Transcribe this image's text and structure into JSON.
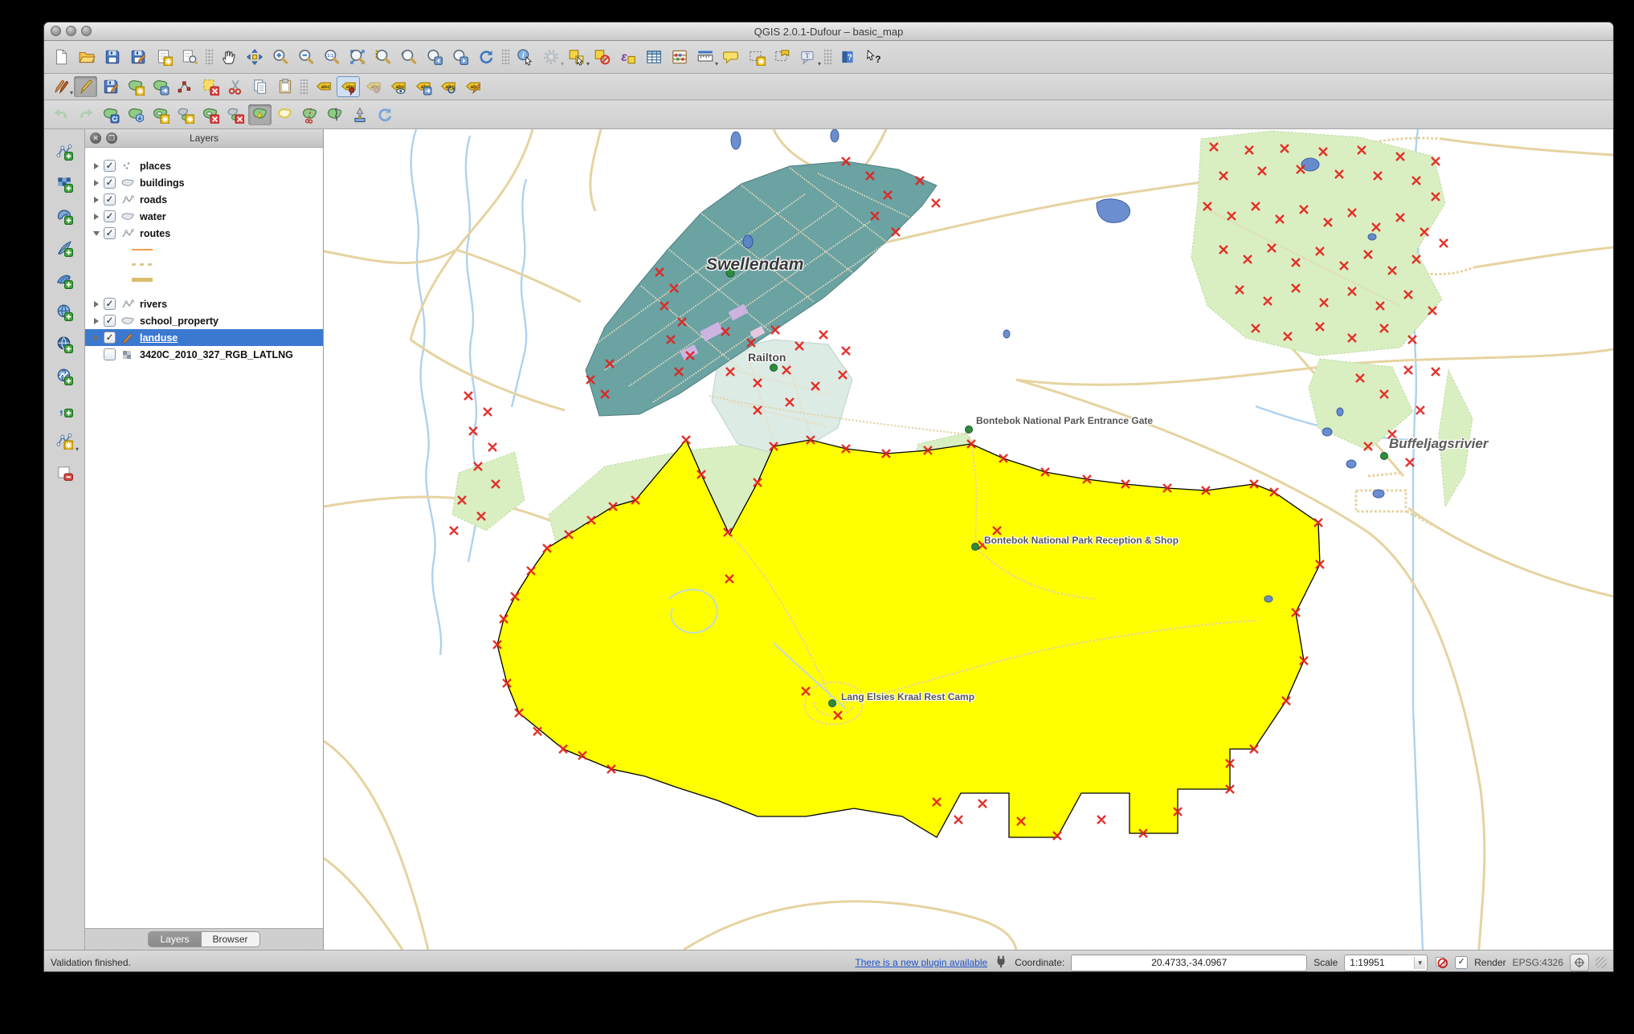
{
  "window": {
    "title": "QGIS 2.0.1-Dufour – basic_map",
    "controls": [
      "close-button",
      "minimize-button",
      "zoom-button"
    ]
  },
  "toolbars": {
    "row1": [
      "new-project",
      "open-project",
      "save-project",
      "save-project-as",
      "new-composer",
      "composer-manager",
      "|",
      "pan-map",
      "pan-to-selection",
      "zoom-in",
      "zoom-out",
      "zoom-native",
      "zoom-full",
      "zoom-to-selection",
      "zoom-to-layer",
      "zoom-last",
      "zoom-next",
      "refresh",
      "|",
      "identify",
      {
        "icon": "feature-action",
        "dropdown": true,
        "disabled": true
      },
      {
        "icon": "select-features",
        "dropdown": true
      },
      "deselect-all",
      "select-by-expression",
      "attribute-table",
      "field-calculator",
      {
        "icon": "measure",
        "dropdown": true
      },
      "map-tips",
      "new-bookmark",
      "show-bookmarks",
      {
        "icon": "text-annotation",
        "dropdown": true
      },
      "|",
      "help-contents",
      "whats-this"
    ],
    "row2": [
      {
        "icon": "current-edits",
        "dropdown": true
      },
      {
        "icon": "toggle-editing",
        "active": true
      },
      "save-edits",
      "add-feature",
      "move-feature",
      "node-tool",
      "delete-selected",
      "cut-features",
      "copy-features",
      "paste-features",
      "|",
      "labeling",
      {
        "icon": "pin-label",
        "framed": true
      },
      {
        "icon": "highlight-pinned-labels",
        "disabled": true
      },
      "show-hide-labels",
      "move-label",
      "rotate-label",
      "change-label-properties"
    ],
    "row3": [
      {
        "icon": "undo",
        "disabled": true
      },
      {
        "icon": "redo",
        "disabled": true
      },
      "rotate-feature",
      "simplify-feature",
      "add-ring",
      "add-part",
      "delete-ring",
      "delete-part",
      {
        "icon": "reshape-features",
        "active": true
      },
      "offset-curve",
      "split-features",
      "split-parts",
      "merge-features",
      "rotate-point-symbols"
    ],
    "dock": [
      "add-vector-layer",
      "add-raster-layer",
      "add-postgis-layer",
      "add-spatialite-layer",
      "add-mssql-layer",
      "add-wms-layer",
      "add-wcs-layer",
      "add-wfs-layer",
      "add-delimited-text-layer",
      {
        "icon": "new-shapefile-layer",
        "dropdown": true
      },
      "remove-layer"
    ]
  },
  "layers_panel": {
    "title": "Layers",
    "items": [
      {
        "name": "places",
        "icon": "points",
        "checked": true,
        "expander": "collapsed"
      },
      {
        "name": "buildings",
        "icon": "polygon",
        "checked": true,
        "expander": "collapsed"
      },
      {
        "name": "roads",
        "icon": "line",
        "checked": true,
        "expander": "collapsed"
      },
      {
        "name": "water",
        "icon": "polygon",
        "checked": true,
        "expander": "collapsed"
      },
      {
        "name": "routes",
        "icon": "line",
        "checked": true,
        "expander": "expanded",
        "legend": [
          "thin-orange-line",
          "dashed-tan-line",
          "thick-tan-line"
        ]
      },
      {
        "name": "rivers",
        "icon": "line",
        "checked": true,
        "expander": "collapsed"
      },
      {
        "name": "school_property",
        "icon": "polygon",
        "checked": true,
        "expander": "collapsed"
      },
      {
        "name": "landuse",
        "icon": "pencil",
        "checked": true,
        "expander": "collapsed",
        "selected": true,
        "editing": true
      },
      {
        "name": "3420C_2010_327_RGB_LATLNG",
        "icon": "raster",
        "checked": false,
        "expander": "none"
      }
    ],
    "tabs": [
      {
        "label": "Layers",
        "active": true
      },
      {
        "label": "Browser",
        "active": false
      }
    ]
  },
  "map": {
    "labels": [
      {
        "text": "Swellendam",
        "kind": "town"
      },
      {
        "text": "Railton",
        "kind": "town2"
      },
      {
        "text": "Bontebok National Park Entrance Gate",
        "kind": "poi"
      },
      {
        "text": "Bontebok National Park Reception & Shop",
        "kind": "poi"
      },
      {
        "text": "Lang Elsies Kraal Rest Camp",
        "kind": "poi"
      },
      {
        "text": "Buffeljagsrivier",
        "kind": "river"
      }
    ],
    "colors": {
      "landuse_fill": "#ffff00",
      "park_fill": "#d9efc2",
      "urban_fill": "#6ba2a2",
      "road": "#e6d3a0",
      "river": "#aed2ee",
      "vertex_marker": "#e3211c",
      "label_dot": "#2e8b3d"
    }
  },
  "statusbar": {
    "message": "Validation finished.",
    "plugin_link": "There is a new plugin available",
    "coordinate_label": "Coordinate:",
    "coordinate_value": "20.4733,-34.0967",
    "scale_label": "Scale",
    "scale_value": "1:19951",
    "render_label": "Render",
    "render_checked": true,
    "epsg": "EPSG:4326"
  }
}
